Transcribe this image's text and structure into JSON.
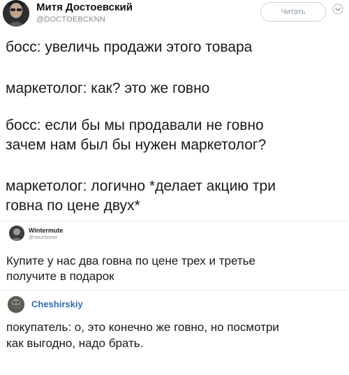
{
  "tweet": {
    "author_name": "Митя Достоевский",
    "author_handle": "@DOCTOEBCKNN",
    "follow_label": "Читать",
    "lines": [
      "босс: увеличь продажи этого товара",
      "маркетолог: как? это же говно",
      "босс: если бы мы продавали не говно",
      "зачем нам был бы нужен маркетолог?",
      "маркетолог: логично *делает акцию три",
      "говна по цене двух*"
    ]
  },
  "reply1": {
    "author_name": "Wintermute",
    "author_handle": "@neur0mnor",
    "lines": [
      "Купите у нас два говна по цене трех и третье",
      "получите в подарок"
    ]
  },
  "reply2": {
    "author_name": "Cheshirskiy",
    "lines": [
      "покупатель: о, это конечно же говно, но посмотри",
      "как выгодно, надо брать."
    ]
  },
  "colors": {
    "link": "#2a6fb3",
    "muted": "#8a8a8a",
    "text": "#1a1a1a"
  },
  "icons": [
    "chevron-down-icon"
  ]
}
